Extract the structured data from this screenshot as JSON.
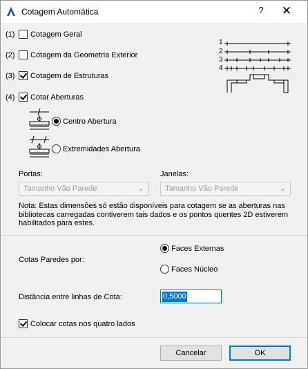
{
  "window": {
    "title": "Cotagem Automática",
    "help_label": "?",
    "close_label": "✕"
  },
  "options": [
    {
      "number": "(1)",
      "label": "Cotagem Geral",
      "checked": false
    },
    {
      "number": "(2)",
      "label": "Cotagem da Geometria Exterior",
      "checked": false
    },
    {
      "number": "(3)",
      "label": "Cotagem de Estruturas",
      "checked": true
    },
    {
      "number": "(4)",
      "label": "Cotar Aberturas",
      "checked": true
    }
  ],
  "preview_numbers": [
    "1",
    "2",
    "3",
    "4"
  ],
  "opening_modes": [
    {
      "label": "Centro Abertura",
      "selected": true
    },
    {
      "label": "Extremidades Abertura",
      "selected": false
    }
  ],
  "doors": {
    "label": "Portas:",
    "value": "Tamanho Vão Parede"
  },
  "windows": {
    "label": "Janelas:",
    "value": "Tamanho Vão Parede"
  },
  "note": "Nota: Estas dimensões só estão disponíveis para cotagem se as aberturas nas bibliotecas carregadas contiverem tais dados e os pontos quentes 2D estiverem habilitados para estes.",
  "walls": {
    "label": "Cotas Paredes por:",
    "choices": [
      {
        "label": "Faces Externas",
        "selected": true
      },
      {
        "label": "Faces Núcleo",
        "selected": false
      }
    ]
  },
  "distance": {
    "label": "Distância entre linhas de Cota:",
    "value": "0,5000"
  },
  "four_sides": {
    "label": "Colocar cotas nos quatro lados",
    "checked": true
  },
  "buttons": {
    "cancel": "Cancelar",
    "ok": "OK"
  }
}
